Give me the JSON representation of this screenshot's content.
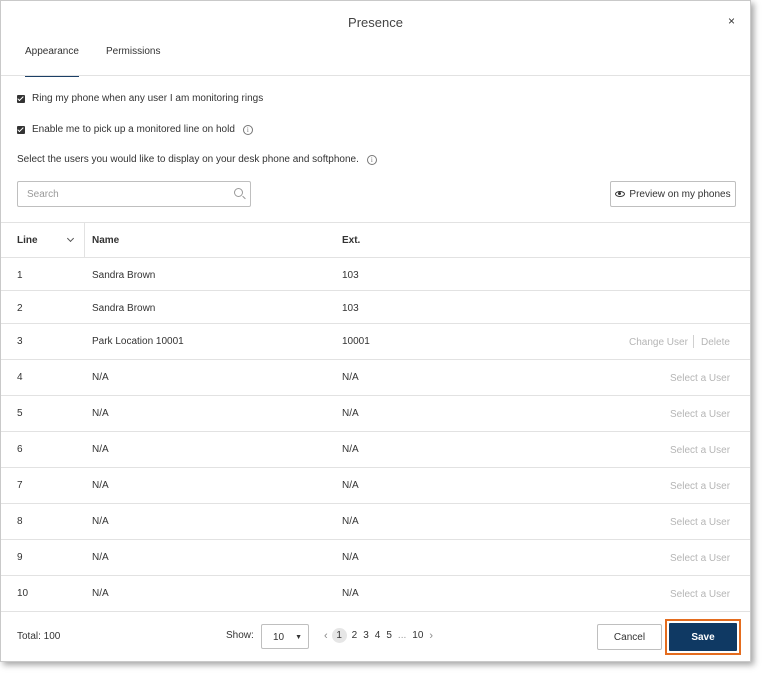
{
  "dialog": {
    "title": "Presence",
    "close_label": "×"
  },
  "tabs": [
    {
      "label": "Appearance",
      "active": true
    },
    {
      "label": "Permissions",
      "active": false
    }
  ],
  "options": {
    "ring_label": "Ring my phone when any user I am monitoring rings",
    "ring_checked": true,
    "pickup_label": "Enable me to pick up a monitored line on hold",
    "pickup_checked": true,
    "select_users_text": "Select the users you would like to display on your desk phone and softphone."
  },
  "search": {
    "placeholder": "Search",
    "value": ""
  },
  "preview_button": "Preview on my phones",
  "table": {
    "headers": {
      "line": "Line",
      "name": "Name",
      "ext": "Ext."
    },
    "rows": [
      {
        "line": "1",
        "name": "Sandra Brown",
        "ext": "103"
      },
      {
        "line": "2",
        "name": "Sandra Brown",
        "ext": "103"
      },
      {
        "line": "3",
        "name": "Park Location 10001",
        "ext": "10001",
        "change_user": "Change User",
        "delete": "Delete"
      },
      {
        "line": "4",
        "name": "N/A",
        "ext": "N/A",
        "select_user": "Select a User"
      },
      {
        "line": "5",
        "name": "N/A",
        "ext": "N/A",
        "select_user": "Select a User"
      },
      {
        "line": "6",
        "name": "N/A",
        "ext": "N/A",
        "select_user": "Select a User"
      },
      {
        "line": "7",
        "name": "N/A",
        "ext": "N/A",
        "select_user": "Select a User"
      },
      {
        "line": "8",
        "name": "N/A",
        "ext": "N/A",
        "select_user": "Select a User"
      },
      {
        "line": "9",
        "name": "N/A",
        "ext": "N/A",
        "select_user": "Select a User"
      },
      {
        "line": "10",
        "name": "N/A",
        "ext": "N/A",
        "select_user": "Select a User"
      }
    ]
  },
  "footer": {
    "total": "Total: 100",
    "show_label": "Show:",
    "show_value": "10",
    "pages": [
      "1",
      "2",
      "3",
      "4",
      "5"
    ],
    "current_page": "1",
    "ellipsis": "...",
    "last_page": "10",
    "cancel": "Cancel",
    "save": "Save"
  },
  "colors": {
    "save_bg": "#0f3963",
    "save_highlight": "#e46c1e",
    "active_tab_underline": "#1b3f66"
  }
}
